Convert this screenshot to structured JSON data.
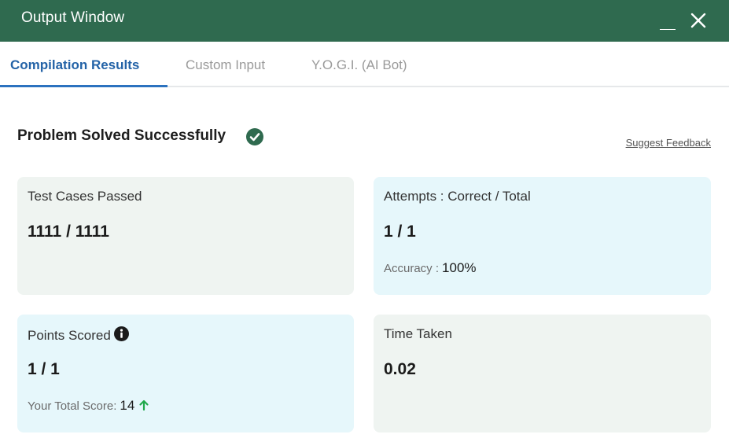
{
  "window": {
    "title": "Output Window"
  },
  "tabs": [
    {
      "label": "Compilation Results",
      "active": true
    },
    {
      "label": "Custom Input",
      "active": false
    },
    {
      "label": "Y.O.G.I. (AI Bot)",
      "active": false
    }
  ],
  "status": {
    "message": "Problem Solved Successfully",
    "icon": "check-circle-icon"
  },
  "feedback_link": "Suggest Feedback",
  "cards": {
    "test_cases": {
      "label": "Test Cases Passed",
      "value": "1111 / 1111"
    },
    "attempts": {
      "label": "Attempts : Correct / Total",
      "value": "1 / 1",
      "sub_label": "Accuracy :",
      "sub_value": "100%"
    },
    "points": {
      "label": "Points Scored",
      "value": "1 / 1",
      "sub_label": "Your Total Score:",
      "sub_value": "14",
      "icon": "info-icon"
    },
    "time": {
      "label": "Time Taken",
      "value": "0.02"
    }
  },
  "colors": {
    "titlebar": "#2f6a4f",
    "active_tab": "#2463a7",
    "success": "#2f6a4f",
    "card_grey": "#eff4f1",
    "card_blue": "#e6f7fb",
    "arrow_up": "#1fa84a"
  }
}
